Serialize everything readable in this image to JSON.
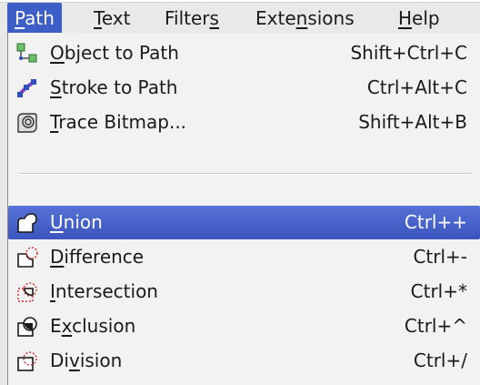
{
  "menubar": {
    "items": [
      {
        "pre": "",
        "u": "P",
        "post": "ath"
      },
      {
        "pre": "",
        "u": "T",
        "post": "ext"
      },
      {
        "pre": "Filter",
        "u": "s",
        "post": ""
      },
      {
        "pre": "Exte",
        "u": "n",
        "post": "sions"
      },
      {
        "pre": "",
        "u": "H",
        "post": "elp"
      }
    ]
  },
  "menu": {
    "items": [
      {
        "pre": "",
        "u": "O",
        "post": "bject to Path",
        "shortcut": "Shift+Ctrl+C",
        "icon": "object-to-path-icon"
      },
      {
        "pre": "",
        "u": "S",
        "post": "troke to Path",
        "shortcut": "Ctrl+Alt+C",
        "icon": "stroke-to-path-icon"
      },
      {
        "pre": "",
        "u": "T",
        "post": "race Bitmap...",
        "shortcut": "Shift+Alt+B",
        "icon": "trace-bitmap-icon"
      },
      {
        "pre": "",
        "u": "U",
        "post": "nion",
        "shortcut": "Ctrl++",
        "icon": "union-icon"
      },
      {
        "pre": "",
        "u": "D",
        "post": "ifference",
        "shortcut": "Ctrl+-",
        "icon": "difference-icon"
      },
      {
        "pre": "",
        "u": "I",
        "post": "ntersection",
        "shortcut": "Ctrl+*",
        "icon": "intersection-icon"
      },
      {
        "pre": "E",
        "u": "x",
        "post": "clusion",
        "shortcut": "Ctrl+^",
        "icon": "exclusion-icon"
      },
      {
        "pre": "Di",
        "u": "v",
        "post": "ision",
        "shortcut": "Ctrl+/",
        "icon": "division-icon"
      }
    ]
  },
  "colors": {
    "highlight": "#3d5ec6",
    "menu_bg": "#f2f2f2",
    "icon_red": "#d03030",
    "icon_blue": "#3050c0"
  }
}
